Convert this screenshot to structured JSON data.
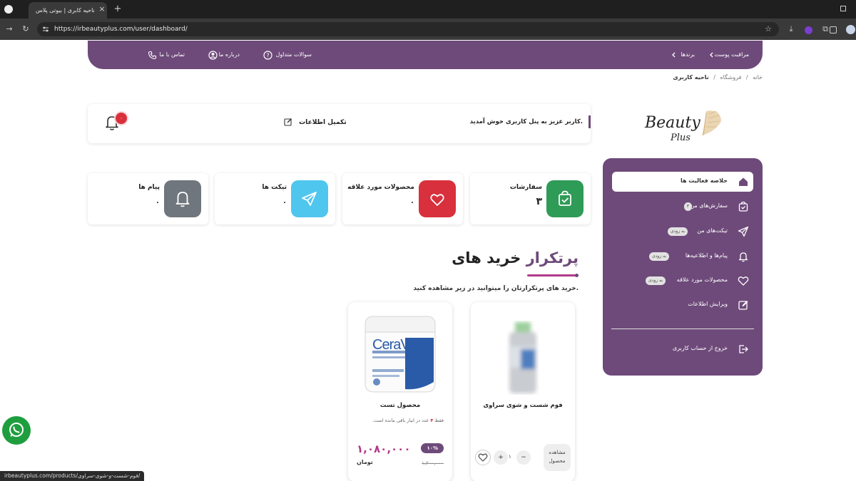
{
  "browser": {
    "tab_title": "ناحیه کابری | بیوتی پلاس",
    "new_tab": "+",
    "close_tab": "×",
    "url": "https://irbeautyplus.com/user/dashboard/",
    "status_url": "irbeautyplus.com/products/فوم-شست-و-شوی-سراوی/"
  },
  "nav": {
    "items": [
      {
        "label": "مراقبت پوست"
      },
      {
        "label": "برندها"
      },
      {
        "label": "سوالات متداول"
      },
      {
        "label": "درباره ما"
      },
      {
        "label": "تماس با ما"
      }
    ]
  },
  "breadcrumb": {
    "home": "خانه",
    "shop": "فروشگاه",
    "current": "ناحیه کاربری",
    "sep": "/"
  },
  "logo": {
    "line1": "Beauty",
    "line2": "Plus"
  },
  "sidebar": {
    "items": [
      {
        "label": "خلاصه فعالیت ها",
        "icon": "home-icon",
        "active": true
      },
      {
        "label": "سفارش‌های من",
        "icon": "bag-check-icon",
        "badge": "۳"
      },
      {
        "label": "تیکت‌های من",
        "icon": "send-icon",
        "badge": "به زودی"
      },
      {
        "label": "پیام‌ها و اطلاعیه‌ها",
        "icon": "bell-icon",
        "badge": "به زودی"
      },
      {
        "label": "محصولات مورد علاقه",
        "icon": "heart-icon",
        "badge": "به زودی"
      },
      {
        "label": "ویرایش اطلاعات",
        "icon": "edit-icon"
      }
    ],
    "logout": "خروج از حساب کاربری"
  },
  "welcome": {
    "message": "کاربر عزیز به پنل کاربری خوش آمدید.",
    "complete_link": "تکمیل اطلاعات",
    "notif_count": "۰"
  },
  "stats": [
    {
      "title": "سفارشات",
      "value": "۳",
      "color": "#2e9b57",
      "icon": "bag-check-icon"
    },
    {
      "title": "محصولات مورد علاقه",
      "value": "۰",
      "color": "#d8303d",
      "icon": "heart-icon"
    },
    {
      "title": "تیکت ها",
      "value": "۰",
      "color": "#4fc6ee",
      "icon": "send-icon"
    },
    {
      "title": "پیام ها",
      "value": "۰",
      "color": "#6f767d",
      "icon": "bell-icon"
    }
  ],
  "section": {
    "title_a": "خرید های",
    "title_b": "پرتکرار",
    "subtitle": "خرید های پرتکرارتان را میتوانید در زیر مشاهده کنید."
  },
  "products": [
    {
      "name": "فوم شست و شوی سراوی",
      "view_label": "مشاهده محصول",
      "qty": "۱",
      "minus": "−",
      "plus": "+"
    },
    {
      "name": "محصول تست",
      "stock_prefix": "فقط",
      "stock_count": "۴",
      "stock_suffix": "عدد در انبار باقی مانده است.",
      "price": "۱,۰۸۰,۰۰۰",
      "currency": "تومان",
      "discount": "۱۰%",
      "old_price": "۱,۲۰۰,۰۰۰",
      "brand_on_pack": "CeraVe"
    }
  ],
  "colors": {
    "brand": "#6e4a7a",
    "accent": "#b23a8a"
  }
}
